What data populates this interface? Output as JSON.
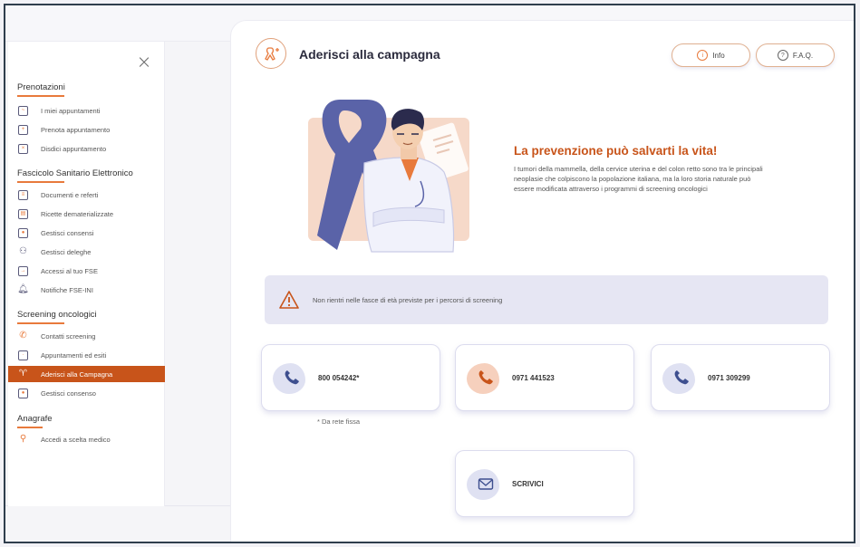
{
  "sidebar": {
    "close_icon": "×",
    "sections": [
      {
        "title": "Prenotazioni",
        "items": [
          {
            "label": "I miei appuntamenti",
            "icon": "calendar-list-icon"
          },
          {
            "label": "Prenota appuntamento",
            "icon": "calendar-plus-icon"
          },
          {
            "label": "Disdici appuntamento",
            "icon": "calendar-x-icon"
          }
        ]
      },
      {
        "title": "Fascicolo Sanitario Elettronico",
        "items": [
          {
            "label": "Documenti e referti",
            "icon": "document-icon"
          },
          {
            "label": "Ricette dematerializzate",
            "icon": "prescription-icon"
          },
          {
            "label": "Gestisci consensi",
            "icon": "consent-icon"
          },
          {
            "label": "Gestisci deleghe",
            "icon": "people-icon"
          },
          {
            "label": "Accessi al tuo FSE",
            "icon": "login-icon"
          },
          {
            "label": "Notifiche FSE-INI",
            "icon": "bell-icon"
          }
        ]
      },
      {
        "title": "Screening oncologici",
        "items": [
          {
            "label": "Contatti screening",
            "icon": "phone-contact-icon"
          },
          {
            "label": "Appuntamenti ed esiti",
            "icon": "calendar-icon"
          },
          {
            "label": "Aderisci alla Campagna",
            "icon": "ribbon-add-icon",
            "active": true
          },
          {
            "label": "Gestisci consenso",
            "icon": "consent-icon"
          }
        ]
      },
      {
        "title": "Anagrafe",
        "items": [
          {
            "label": "Accedi a scelta medico",
            "icon": "user-add-icon"
          }
        ]
      }
    ]
  },
  "header": {
    "title": "Aderisci alla campagna",
    "info_label": "Info",
    "faq_label": "F.A.Q."
  },
  "hero": {
    "title": "La prevenzione può salvarti la vita!",
    "text": "I tumori della mammella, della cervice uterina e del colon retto sono tra le principali neoplasie che colpiscono la popolazione italiana, ma la loro storia naturale può essere modificata attraverso i programmi di screening oncologici"
  },
  "alert": {
    "text": "Non rientri nelle fasce di età previste per i percorsi di screening"
  },
  "contacts": {
    "phone1": "800 054242*",
    "phone2": "0971 441523",
    "phone3": "0971 309299",
    "note": "* Da rete fissa",
    "write": "SCRIVICI"
  },
  "colors": {
    "accent": "#c8541a",
    "ribbon": "#5a63a8",
    "alert_bg": "#e6e6f3"
  }
}
